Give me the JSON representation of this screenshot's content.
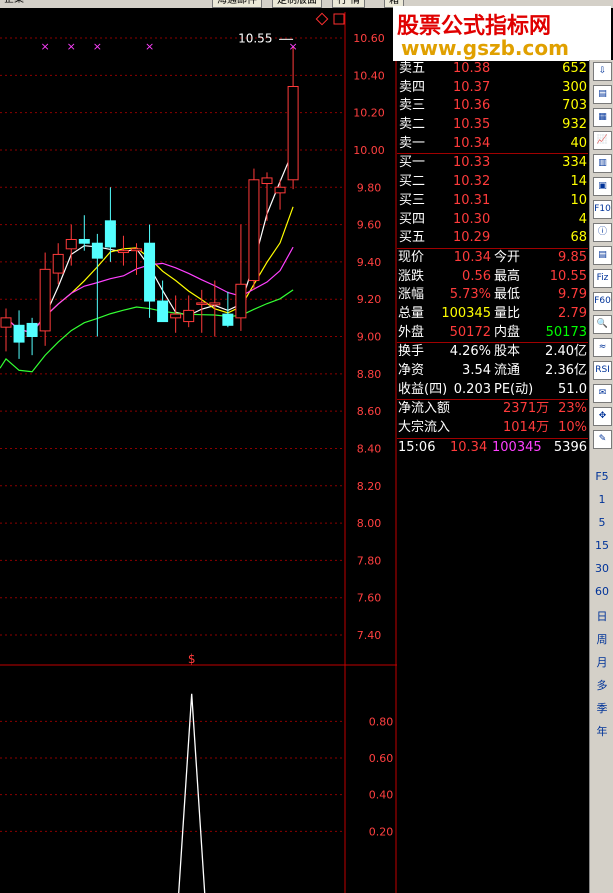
{
  "window": {
    "title_fragment": "企業",
    "toolbar_buttons": [
      "海通邮件",
      "定制版面",
      "行 情",
      "箱"
    ]
  },
  "watermark": {
    "title": "股票公式指标网",
    "url": "www.gszb.com"
  },
  "chart_data": {
    "type": "candlestick",
    "title": "",
    "price_axis_ticks": [
      "10.60",
      "10.40",
      "10.20",
      "10.00",
      "9.80",
      "9.60",
      "9.40",
      "9.20",
      "9.00",
      "8.80",
      "8.60",
      "8.40",
      "8.20",
      "8.00",
      "7.80",
      "7.60",
      "7.40"
    ],
    "ylim": [
      7.3,
      10.65
    ],
    "high_annotation": "10.55",
    "candles": [
      {
        "o": 9.05,
        "h": 9.15,
        "l": 8.92,
        "c": 9.1
      },
      {
        "o": 9.06,
        "h": 9.14,
        "l": 8.88,
        "c": 8.97
      },
      {
        "o": 9.07,
        "h": 9.1,
        "l": 8.9,
        "c": 9.0
      },
      {
        "o": 9.03,
        "h": 9.45,
        "l": 8.95,
        "c": 9.36
      },
      {
        "o": 9.34,
        "h": 9.5,
        "l": 9.28,
        "c": 9.44
      },
      {
        "o": 9.47,
        "h": 9.6,
        "l": 9.38,
        "c": 9.52
      },
      {
        "o": 9.52,
        "h": 9.65,
        "l": 9.46,
        "c": 9.5
      },
      {
        "o": 9.5,
        "h": 9.55,
        "l": 9.0,
        "c": 9.42
      },
      {
        "o": 9.62,
        "h": 9.8,
        "l": 9.4,
        "c": 9.48
      },
      {
        "o": 9.45,
        "h": 9.54,
        "l": 9.38,
        "c": 9.46
      },
      {
        "o": 9.46,
        "h": 9.5,
        "l": 9.33,
        "c": 9.47
      },
      {
        "o": 9.5,
        "h": 9.6,
        "l": 9.1,
        "c": 9.19
      },
      {
        "o": 9.19,
        "h": 9.3,
        "l": 9.08,
        "c": 9.08
      },
      {
        "o": 9.1,
        "h": 9.22,
        "l": 9.02,
        "c": 9.12
      },
      {
        "o": 9.08,
        "h": 9.22,
        "l": 9.05,
        "c": 9.14
      },
      {
        "o": 9.18,
        "h": 9.25,
        "l": 9.02,
        "c": 9.18
      },
      {
        "o": 9.17,
        "h": 9.3,
        "l": 9.0,
        "c": 9.18
      },
      {
        "o": 9.12,
        "h": 9.24,
        "l": 9.05,
        "c": 9.06
      },
      {
        "o": 9.1,
        "h": 9.6,
        "l": 9.03,
        "c": 9.28
      },
      {
        "o": 9.3,
        "h": 9.9,
        "l": 9.25,
        "c": 9.84
      },
      {
        "o": 9.82,
        "h": 9.88,
        "l": 9.62,
        "c": 9.85
      },
      {
        "o": 9.77,
        "h": 9.84,
        "l": 9.68,
        "c": 9.8
      },
      {
        "o": 9.84,
        "h": 10.55,
        "l": 9.79,
        "c": 10.34
      }
    ],
    "signal_markers": [
      "×",
      "×",
      "×",
      "×",
      "×"
    ],
    "indicator_axis_ticks": [
      "0.80",
      "0.60",
      "0.40",
      "0.20"
    ],
    "indicator_ylim": [
      0,
      1.0
    ],
    "indicator_marker": "$",
    "indicator_spike_value": 0.95
  },
  "quote": {
    "asks": [
      {
        "label": "卖五",
        "price": "10.38",
        "vol": "652"
      },
      {
        "label": "卖四",
        "price": "10.37",
        "vol": "300"
      },
      {
        "label": "卖三",
        "price": "10.36",
        "vol": "703"
      },
      {
        "label": "卖二",
        "price": "10.35",
        "vol": "932"
      },
      {
        "label": "卖一",
        "price": "10.34",
        "vol": "40"
      }
    ],
    "bids": [
      {
        "label": "买一",
        "price": "10.33",
        "vol": "334"
      },
      {
        "label": "买二",
        "price": "10.32",
        "vol": "14"
      },
      {
        "label": "买三",
        "price": "10.31",
        "vol": "10"
      },
      {
        "label": "买四",
        "price": "10.30",
        "vol": "4"
      },
      {
        "label": "买五",
        "price": "10.29",
        "vol": "68"
      }
    ],
    "stats": [
      {
        "l1": "现价",
        "v1": "10.34",
        "l2": "今开",
        "v2": "9.85"
      },
      {
        "l1": "涨跌",
        "v1": "0.56",
        "l2": "最高",
        "v2": "10.55"
      },
      {
        "l1": "涨幅",
        "v1": "5.73%",
        "l2": "最低",
        "v2": "9.79"
      },
      {
        "l1": "总量",
        "v1": "100345",
        "l2": "量比",
        "v2": "2.79"
      },
      {
        "l1": "外盘",
        "v1": "50172",
        "l2": "内盘",
        "v2": "50173"
      }
    ],
    "fund": [
      {
        "l1": "换手",
        "v1": "4.26%",
        "l2": "股本",
        "v2": "2.40亿"
      },
      {
        "l1": "净资",
        "v1": "3.54",
        "l2": "流通",
        "v2": "2.36亿"
      },
      {
        "l1": "收益(四)",
        "v1": "0.203",
        "l2": "PE(动)",
        "v2": "51.0"
      }
    ],
    "flow": [
      {
        "label": "净流入额",
        "value": "2371万",
        "pct": "23%"
      },
      {
        "label": "大宗流入",
        "value": "1014万",
        "pct": "10%"
      }
    ],
    "tick": {
      "time": "15:06",
      "price": "10.34",
      "vol": "100345",
      "num": "5396"
    }
  },
  "sidebar": {
    "icons": [
      "arrow-down-icon",
      "report-icon",
      "grid-icon",
      "line-chart-icon",
      "candles-icon",
      "windows-icon",
      "f10-icon",
      "info-icon",
      "book-icon",
      "fiz-icon",
      "f60-icon",
      "search-icon",
      "wave-icon",
      "rsi-icon",
      "mail-icon",
      "move-icon",
      "pencil-icon"
    ],
    "icon_labels": [
      "⇩",
      "▤",
      "▦",
      "📈",
      "▥",
      "▣",
      "F10",
      "ⓘ",
      "▤",
      "Fiz",
      "F60",
      "🔍",
      "≈",
      "RSI",
      "✉",
      "✥",
      "✎"
    ],
    "periods": [
      "F5",
      "1",
      "5",
      "15",
      "30",
      "60",
      "日",
      "周",
      "月",
      "多",
      "季",
      "年"
    ]
  }
}
